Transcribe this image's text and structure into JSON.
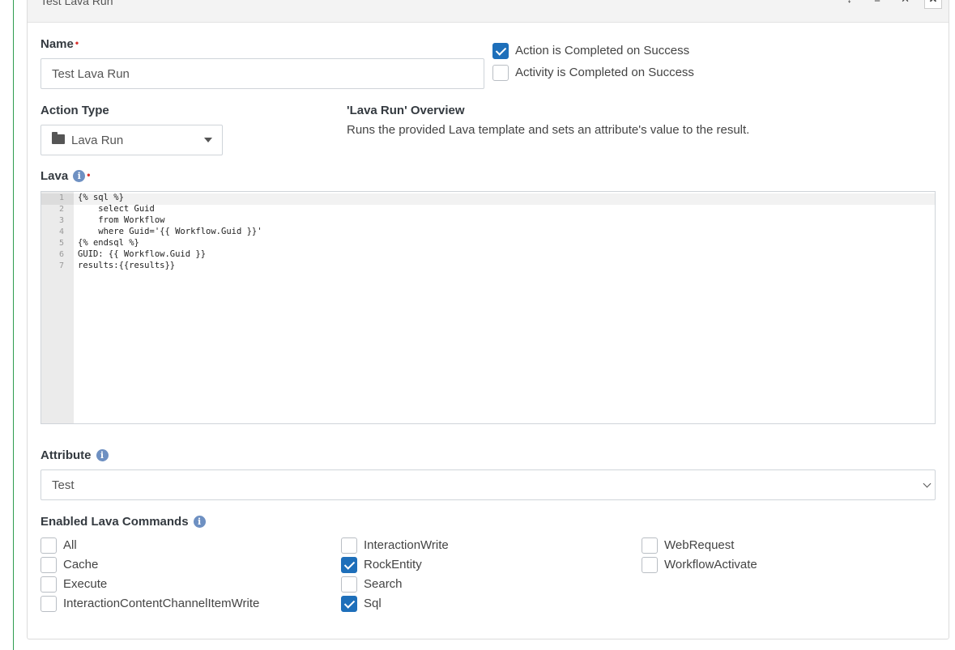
{
  "panel": {
    "title": "Test Lava Run",
    "tools": [
      "↕",
      "≡",
      "✕",
      "✕"
    ]
  },
  "name_field": {
    "label": "Name",
    "required_mark": "•",
    "value": "Test Lava Run"
  },
  "completion_options": [
    {
      "label": "Action is Completed on Success",
      "checked": true
    },
    {
      "label": "Activity is Completed on Success",
      "checked": false
    }
  ],
  "action_type": {
    "label": "Action Type",
    "value": "Lava Run",
    "icon": "folder-icon"
  },
  "overview": {
    "title": "'Lava Run' Overview",
    "description": "Runs the provided Lava template and sets an attribute's value to the result."
  },
  "lava": {
    "label": "Lava",
    "required_mark": "•",
    "line_numbers": [
      "1",
      "2",
      "3",
      "4",
      "5",
      "6",
      "7"
    ],
    "code": [
      "{% sql %}",
      "    select Guid",
      "    from Workflow",
      "    where Guid='{{ Workflow.Guid }}'",
      "{% endsql %}",
      "GUID: {{ Workflow.Guid }}",
      "results:{{results}}"
    ]
  },
  "attribute": {
    "label": "Attribute",
    "value": "Test"
  },
  "enabled_commands": {
    "label": "Enabled Lava Commands",
    "columns": [
      [
        {
          "label": "All",
          "checked": false
        },
        {
          "label": "Cache",
          "checked": false
        },
        {
          "label": "Execute",
          "checked": false
        },
        {
          "label": "InteractionContentChannelItemWrite",
          "checked": false
        }
      ],
      [
        {
          "label": "InteractionWrite",
          "checked": false
        },
        {
          "label": "RockEntity",
          "checked": true
        },
        {
          "label": "Search",
          "checked": false
        },
        {
          "label": "Sql",
          "checked": true
        }
      ],
      [
        {
          "label": "WebRequest",
          "checked": false
        },
        {
          "label": "WorkflowActivate",
          "checked": false
        }
      ]
    ]
  }
}
